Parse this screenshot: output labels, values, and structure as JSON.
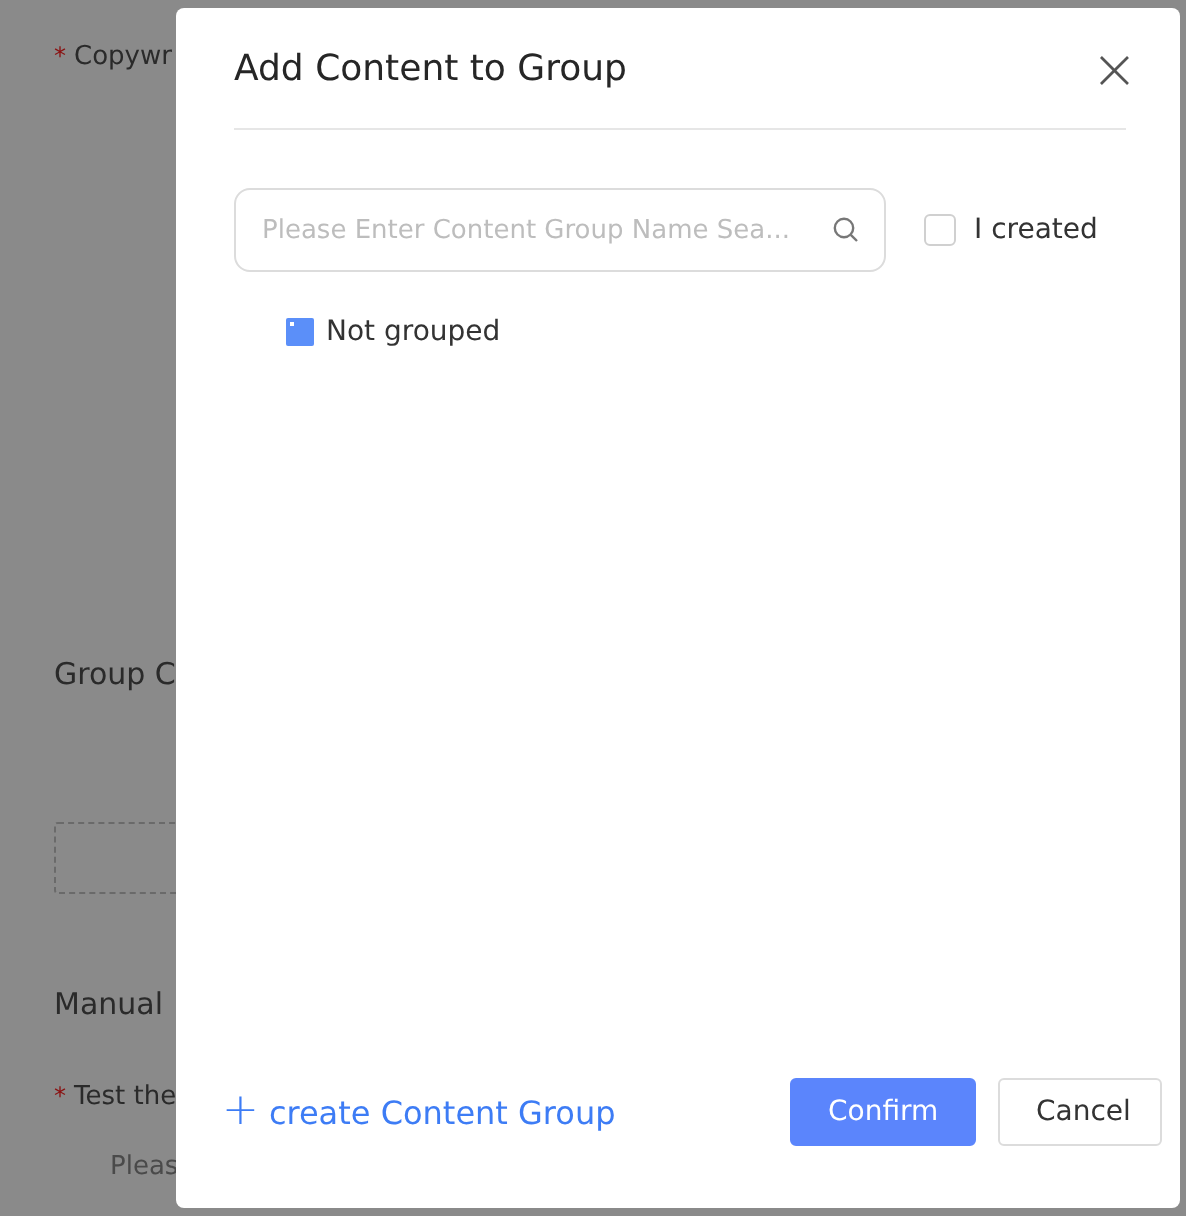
{
  "background_form": {
    "fields": [
      {
        "kind": "required",
        "mark": "*",
        "label": "Copywr"
      },
      {
        "kind": "heading",
        "label": "Group C"
      },
      {
        "kind": "dropzone"
      },
      {
        "kind": "heading",
        "label": "Manual"
      },
      {
        "kind": "required",
        "mark": "*",
        "label": "Test the"
      },
      {
        "kind": "hint",
        "label": "Pleas"
      }
    ]
  },
  "dialog": {
    "title": "Add Content to Group",
    "close": "×",
    "search": {
      "placeholder": "Please Enter Content Group Name Sea..."
    },
    "filter": {
      "label": "I created",
      "checked": false
    },
    "groups": [
      {
        "name": "Not grouped"
      }
    ],
    "create_link": {
      "icon": "+",
      "label": "create Content Group"
    },
    "buttons": [
      {
        "kind": "primary",
        "label": "Confirm"
      },
      {
        "kind": "default",
        "label": "Cancel"
      }
    ]
  }
}
